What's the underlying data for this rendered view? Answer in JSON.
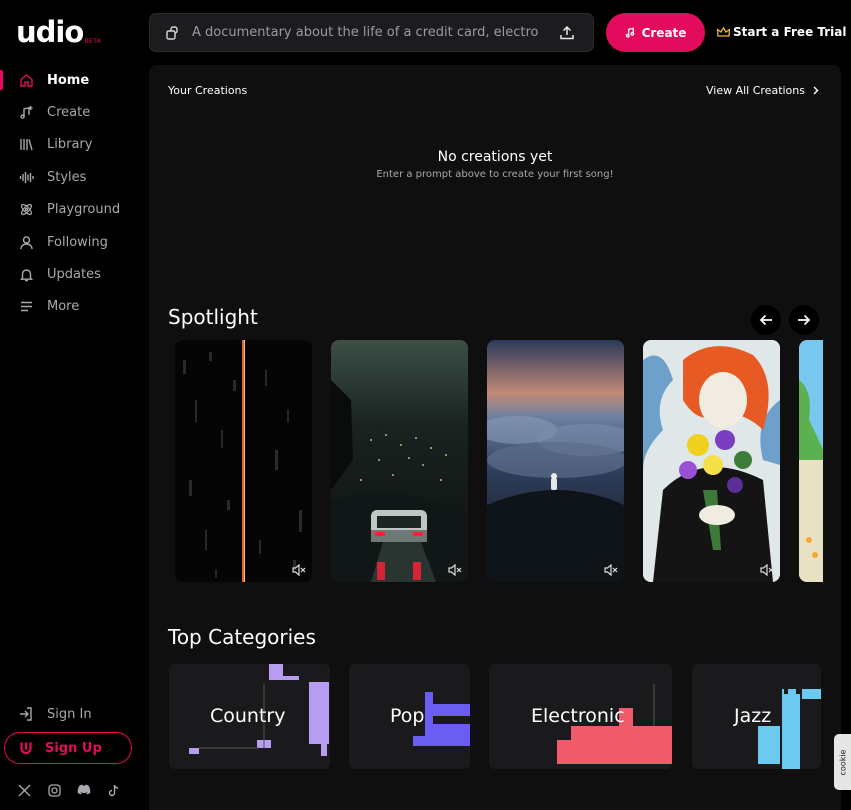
{
  "brand": {
    "name": "udio",
    "badge": "BETA",
    "accent": "#e30b5d"
  },
  "search": {
    "placeholder": "A documentary about the life of a credit card, electro"
  },
  "header": {
    "create_label": "Create",
    "trial_label": "Start a Free Trial"
  },
  "nav": [
    {
      "label": "Home",
      "icon": "home-icon",
      "active": true
    },
    {
      "label": "Create",
      "icon": "music-plus-icon"
    },
    {
      "label": "Library",
      "icon": "library-icon"
    },
    {
      "label": "Styles",
      "icon": "waveform-icon"
    },
    {
      "label": "Playground",
      "icon": "atom-icon"
    },
    {
      "label": "Following",
      "icon": "user-icon"
    },
    {
      "label": "Updates",
      "icon": "bell-icon"
    },
    {
      "label": "More",
      "icon": "menu-icon"
    }
  ],
  "account": {
    "signin_label": "Sign In",
    "signup_label": "Sign Up"
  },
  "social": [
    "x-icon",
    "instagram-icon",
    "discord-icon",
    "tiktok-icon"
  ],
  "creations": {
    "title": "Your Creations",
    "view_all": "View All Creations",
    "empty_title": "No creations yet",
    "empty_sub": "Enter a prompt above to create your first song!"
  },
  "spotlight": {
    "title": "Spotlight",
    "cards": [
      {
        "theme": "digital-rain"
      },
      {
        "theme": "night-city-car"
      },
      {
        "theme": "clouds-astronaut"
      },
      {
        "theme": "flowers-portrait"
      },
      {
        "theme": "cartoon-partial"
      }
    ]
  },
  "categories": {
    "title": "Top Categories",
    "items": [
      {
        "label": "Country",
        "color": "#b79cf2"
      },
      {
        "label": "Pop",
        "color": "#6b5cf2"
      },
      {
        "label": "Electronic",
        "color": "#f05a6a"
      },
      {
        "label": "Jazz",
        "color": "#6cc9f0"
      }
    ]
  },
  "cookie": {
    "label": "cookie"
  }
}
